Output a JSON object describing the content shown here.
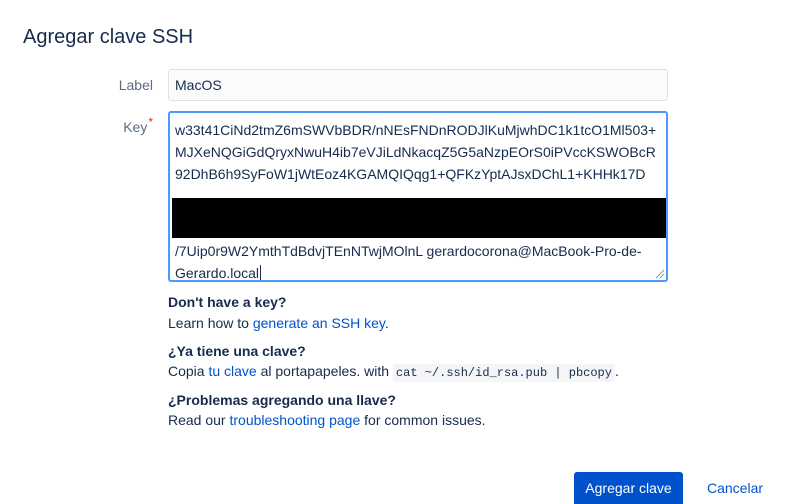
{
  "dialog": {
    "title": "Agregar clave SSH"
  },
  "form": {
    "label_field": {
      "label": "Label",
      "value": "MacOS"
    },
    "key_field": {
      "label": "Key",
      "required_marker": "*",
      "value_visible_top": "w33t41CiNd2tmZ6mSWVbBDR/nNEsFNDnRODJlKuMjwhDC1k1tcO1Ml503+MJXeNQGiGdQryxNwuH4ib7eVJiLdNkacqZ5G5aNzpEOrS0iPVccKSWOBcR92DhB6h9SyFoW1jWtEoz4KGAMQIQqg1+QFKzYptAJsxDChL1+KHHk17D",
      "value_visible_bottom": "/7Uip0r9W2YmthTdBdvjTEnNTwjMOlnL gerardocorona@MacBook-Pro-de-Gerardo.local"
    }
  },
  "help": {
    "no_key": {
      "heading": "Don't have a key?",
      "text_before": "Learn how to ",
      "link": "generate an SSH key",
      "text_after": "."
    },
    "have_key": {
      "heading": "¿Ya tiene una clave?",
      "text_before": "Copia ",
      "link": "tu clave",
      "text_middle": " al portapapeles. with ",
      "code": "cat ~/.ssh/id_rsa.pub | pbcopy",
      "text_after": "."
    },
    "problems": {
      "heading": "¿Problemas agregando una llave?",
      "text_before": "Read our ",
      "link": "troubleshooting page",
      "text_after": " for common issues."
    }
  },
  "buttons": {
    "submit": "Agregar clave",
    "cancel": "Cancelar"
  },
  "colors": {
    "primary": "#0052cc",
    "focus_border": "#4c9aff",
    "required": "#de350b",
    "text": "#172b4d",
    "label_text": "#5e6c84"
  }
}
